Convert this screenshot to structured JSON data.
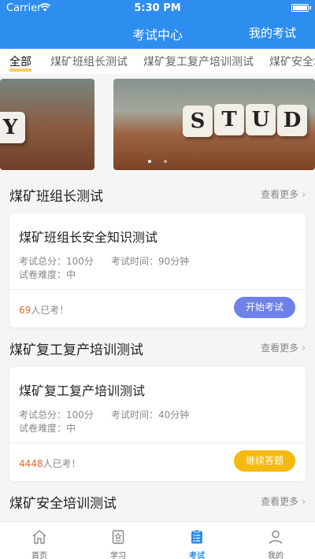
{
  "status_bar": {
    "carrier": "Carrier",
    "time": "5:30 PM"
  },
  "nav": {
    "title": "考试中心",
    "right_link": "我的考试"
  },
  "tabs": [
    "全部",
    "煤矿班组长测试",
    "煤矿复工复产培训测试",
    "煤矿安全培"
  ],
  "banner": {
    "left_letters": "Y",
    "main_letters": [
      "S",
      "T",
      "U",
      "D"
    ]
  },
  "sections": [
    {
      "title": "煤矿班组长测试",
      "more": "查看更多",
      "card": {
        "title": "煤矿班组长安全知识测试",
        "total_score": "考试总分：100分",
        "duration": "考试时间：90分钟",
        "difficulty": "试卷难度：中",
        "taken_count": "69",
        "taken_suffix": "人已考！",
        "button": "开始考试"
      }
    },
    {
      "title": "煤矿复工复产培训测试",
      "more": "查看更多",
      "card": {
        "title": "煤矿复工复产培训测试",
        "total_score": "考试总分：100分",
        "duration": "考试时间：40分钟",
        "difficulty": "试卷难度：中",
        "taken_count": "4448",
        "taken_suffix": "人已考！",
        "button": "继续答题"
      }
    },
    {
      "title": "煤矿安全培训测试",
      "more": "查看更多"
    }
  ],
  "tabbar": [
    "首页",
    "学习",
    "考试",
    "我的"
  ],
  "colors": {
    "primary": "#2e8ef0",
    "start_button": "#6e81ea",
    "continue_button": "#f5b90f",
    "count_highlight": "#e8692c",
    "tab_underline": "#f4c44d"
  }
}
